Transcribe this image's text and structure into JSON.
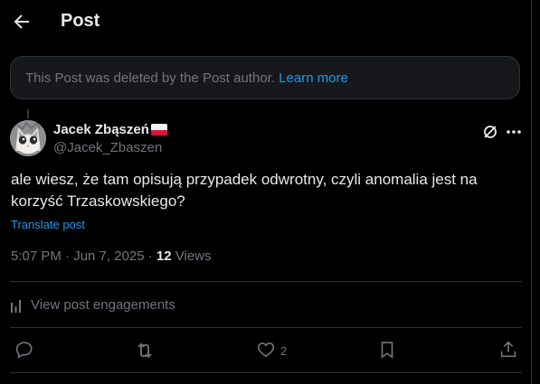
{
  "header": {
    "title": "Post",
    "back_icon": "arrow-left-icon"
  },
  "deleted_notice": {
    "text": "This Post was deleted by the Post author.",
    "link": "Learn more"
  },
  "post": {
    "author_name": "Jacek Zbąszeń",
    "handle": "@Jacek_Zbaszen",
    "flag": "poland-flag",
    "text": "ale wiesz, że tam opisują przypadek odwrotny, czyli anomalia jest na korzyść Trzaskowskiego?",
    "translate": "Translate post",
    "time": "5:07 PM · Jun 7, 2025 · ",
    "views_count": "12",
    "views_label": " Views"
  },
  "engagements_label": "View post engagements",
  "actions": {
    "likes": "2"
  },
  "colors": {
    "background": "#000000",
    "link": "#1d9bf0",
    "muted": "#71767b",
    "text": "#e7e9ea",
    "border": "#2f3336"
  }
}
